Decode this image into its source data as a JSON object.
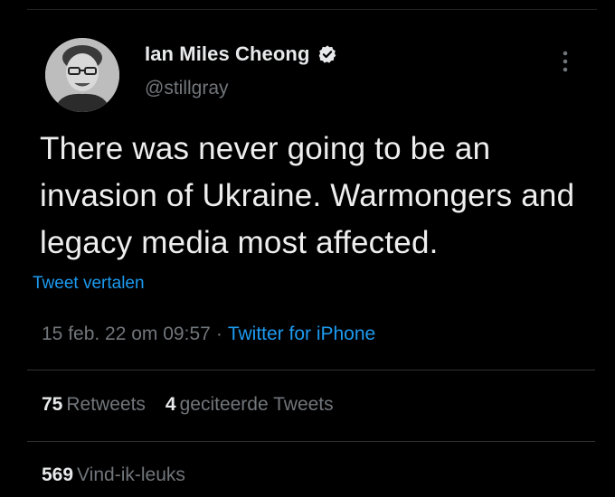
{
  "tweet": {
    "author": {
      "display_name": "Ian Miles Cheong",
      "handle": "@stillgray",
      "verified_icon": "verified-badge-icon",
      "avatar": "avatar"
    },
    "text": "There was never going to be an invasion of Ukraine. Warmongers and legacy media most affected.",
    "translate_label": "Tweet vertalen",
    "timestamp": "15 feb. 22 om 09:57",
    "separator": "·",
    "source": "Twitter for iPhone",
    "more_icon": "more-options-icon"
  },
  "stats": {
    "retweets": {
      "count": "75",
      "label": "Retweets"
    },
    "quotes": {
      "count": "4",
      "label": "geciteerde Tweets"
    },
    "likes": {
      "count": "569",
      "label": "Vind-ik-leuks"
    }
  },
  "colors": {
    "background": "#000000",
    "text_primary": "#e7e9ea",
    "text_secondary": "#71767b",
    "link": "#1d9bf0",
    "divider": "#2f3336"
  }
}
